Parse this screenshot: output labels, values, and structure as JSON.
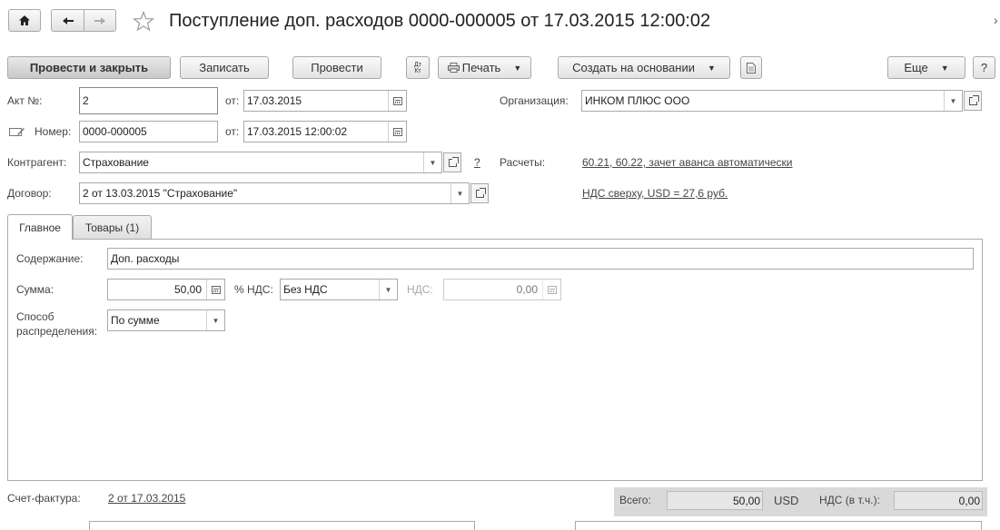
{
  "window": {
    "title": "Поступление доп. расходов 0000-000005 от 17.03.2015 12:00:02"
  },
  "toolbar": {
    "post_close": "Провести и закрыть",
    "save": "Записать",
    "post": "Провести",
    "print": "Печать",
    "create_based": "Создать на основании",
    "more": "Еще",
    "help": "?",
    "dtkt_icon_text": "Дт Кт"
  },
  "header": {
    "act_label": "Акт №:",
    "act_value": "2",
    "from_label": "от:",
    "act_date": "17.03.2015",
    "number_label": "Номер:",
    "number_value": "0000-000005",
    "number_date": "17.03.2015 12:00:02",
    "org_label": "Организация:",
    "org_value": "ИНКОМ ПЛЮС ООО",
    "contractor_label": "Контрагент:",
    "contractor_value": "Страхование",
    "question": "?",
    "settlements_label": "Расчеты:",
    "settlements_link": "60.21, 60.22, зачет аванса автоматически",
    "contract_label": "Договор:",
    "contract_value": "2 от 13.03.2015 \"Страхование\"",
    "vat_link": "НДС сверху, USD = 27,6 руб."
  },
  "tabs": [
    {
      "label": "Главное",
      "active": true
    },
    {
      "label": "Товары (1)",
      "active": false
    }
  ],
  "main": {
    "content_label": "Содержание:",
    "content_value": "Доп. расходы",
    "sum_label": "Сумма:",
    "sum_value": "50,00",
    "vat_rate_label": "% НДС:",
    "vat_rate_value": "Без НДС",
    "vat_label": "НДС:",
    "vat_value": "0,00",
    "distribution_label_1": "Способ",
    "distribution_label_2": "распределения:",
    "distribution_value": "По сумме"
  },
  "footer": {
    "invoice_label": "Счет-фактура:",
    "invoice_link": "2 от 17.03.2015",
    "total_label": "Всего:",
    "total_value": "50,00",
    "currency": "USD",
    "vat_incl_label": "НДС (в т.ч.):",
    "vat_incl_value": "0,00"
  }
}
